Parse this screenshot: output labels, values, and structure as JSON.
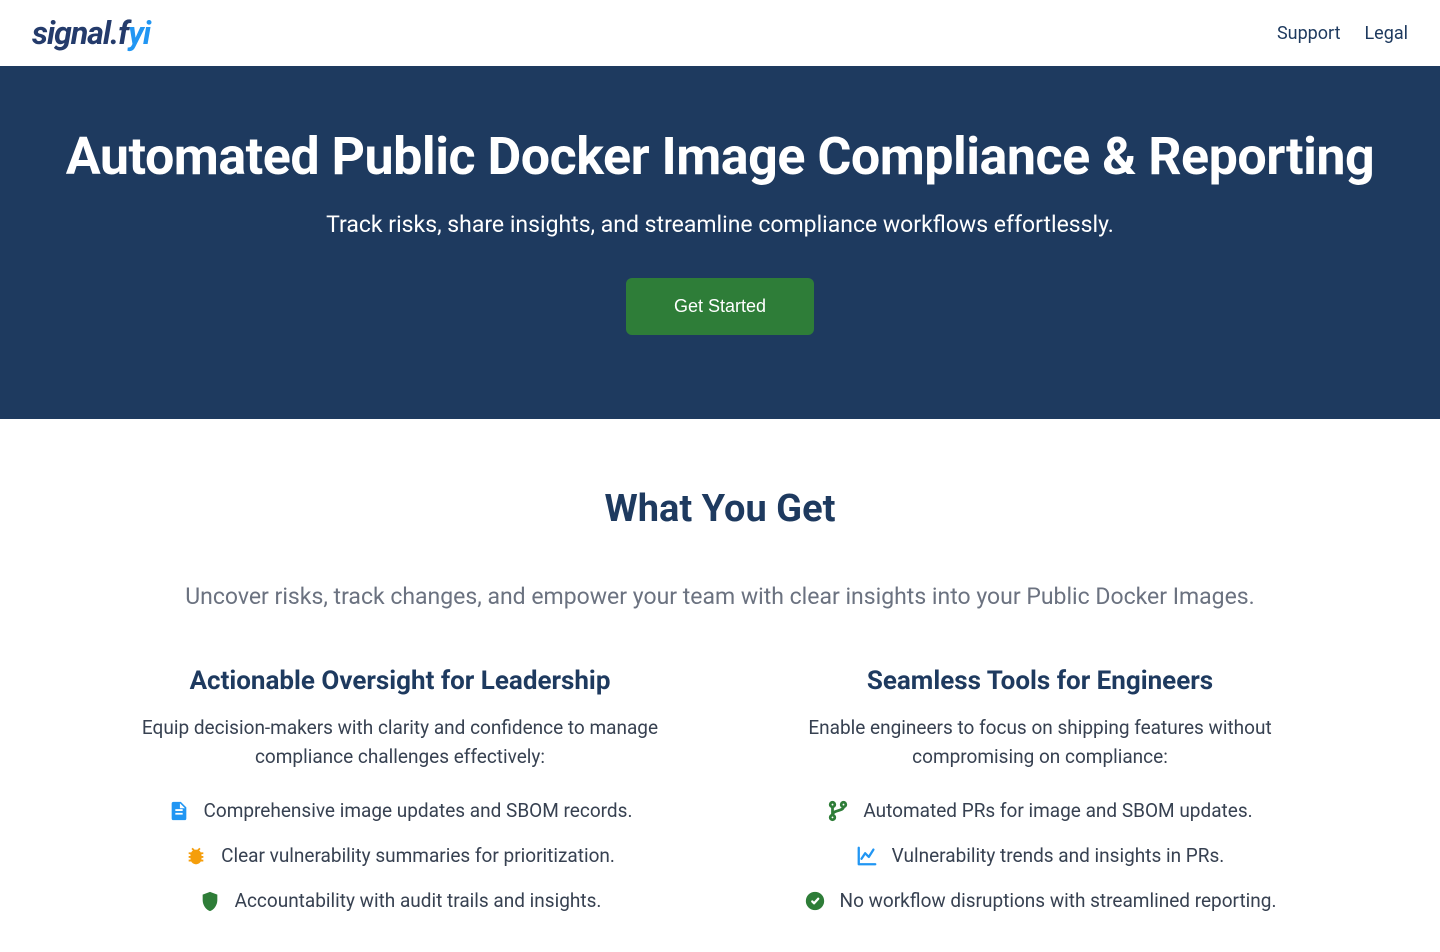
{
  "header": {
    "logo_text": "signal.fyi",
    "nav": {
      "support": "Support",
      "legal": "Legal"
    }
  },
  "hero": {
    "title": "Automated Public Docker Image Compliance & Reporting",
    "subtitle": "Track risks, share insights, and streamline compliance workflows effortlessly.",
    "cta_label": "Get Started"
  },
  "section": {
    "title": "What You Get",
    "sub": "Uncover risks, track changes, and empower your team with clear insights into your Public Docker Images.",
    "columns": [
      {
        "heading": "Actionable Oversight for Leadership",
        "desc": "Equip decision-makers with clarity and confidence to manage compliance challenges effectively:",
        "items": [
          {
            "icon": "file",
            "text": "Comprehensive image updates and SBOM records."
          },
          {
            "icon": "bug",
            "text": "Clear vulnerability summaries for prioritization."
          },
          {
            "icon": "shield",
            "text": "Accountability with audit trails and insights."
          }
        ]
      },
      {
        "heading": "Seamless Tools for Engineers",
        "desc": "Enable engineers to focus on shipping features without compromising on compliance:",
        "items": [
          {
            "icon": "branch",
            "text": "Automated PRs for image and SBOM updates."
          },
          {
            "icon": "chart",
            "text": "Vulnerability trends and insights in PRs."
          },
          {
            "icon": "check",
            "text": "No workflow disruptions with streamlined reporting."
          }
        ]
      }
    ]
  },
  "colors": {
    "hero_bg": "#1e3a5f",
    "cta_bg": "#2e7d38",
    "accent_blue": "#2196f3",
    "icon_blue": "#2196f3",
    "icon_green": "#2e7d38",
    "icon_orange": "#f59e0b"
  }
}
